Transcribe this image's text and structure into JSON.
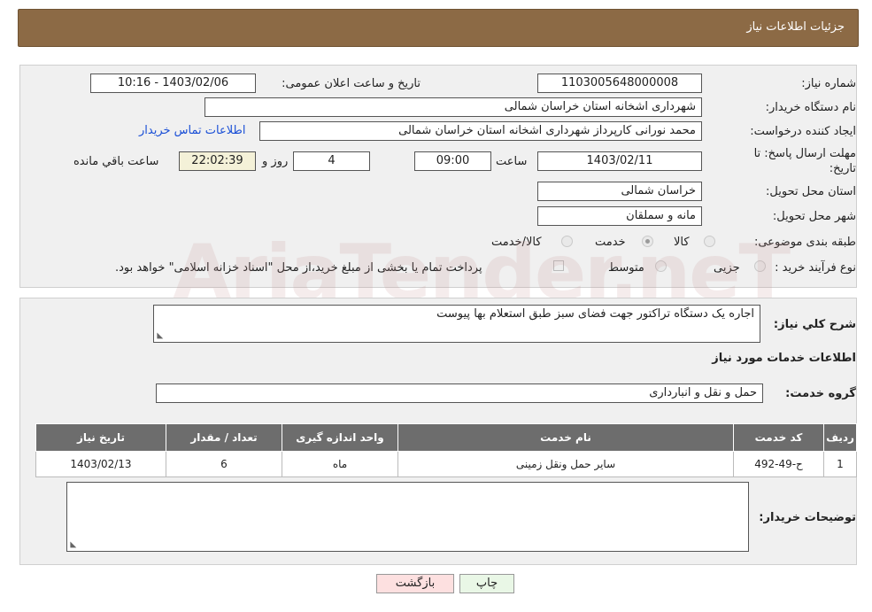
{
  "header": {
    "title": "جزئیات اطلاعات نیاز"
  },
  "form": {
    "need_number_label": "شماره نیاز:",
    "need_number": "1103005648000008",
    "announce_label": "تاریخ و ساعت اعلان عمومی:",
    "announce_value": "1403/02/06 - 10:16",
    "buyer_org_label": "نام دستگاه خریدار:",
    "buyer_org": "شهرداری اشخانه استان خراسان شمالی",
    "creator_label": "ایجاد کننده درخواست:",
    "creator": "محمد نورانی کارپرداز شهرداری اشخانه استان خراسان شمالی",
    "contact_link": "اطلاعات تماس خریدار",
    "deadline_label_1": "مهلت ارسال پاسخ: تا",
    "deadline_label_2": "تاریخ:",
    "deadline_date": "1403/02/11",
    "time_label": "ساعت",
    "deadline_time": "09:00",
    "days_value": "4",
    "days_label": "روز و",
    "remaining_time": "22:02:39",
    "remaining_label": "ساعت باقي مانده",
    "province_label": "استان محل تحویل:",
    "province": "خراسان شمالی",
    "city_label": "شهر محل تحویل:",
    "city": "مانه و سملقان",
    "category_label": "طبقه بندی موضوعی:",
    "category_options": [
      "کالا",
      "خدمت",
      "کالا/خدمت"
    ],
    "category_selected": "خدمت",
    "process_label": "نوع فرآیند خرید :",
    "process_options": [
      "جزیی",
      "متوسط"
    ],
    "payment_note": "پرداخت تمام یا بخشی از مبلغ خرید،از محل \"اسناد خزانه اسلامی\" خواهد بود."
  },
  "details": {
    "summary_label": "شرح کلي نیاز:",
    "summary": "اجاره یک دستگاه تراکتور جهت فضای سبز طبق استعلام بها پیوست",
    "services_heading": "اطلاعات خدمات مورد نیاز",
    "service_group_label": "گروه خدمت:",
    "service_group": "حمل و نقل و انبارداری"
  },
  "table": {
    "headers": [
      "ردیف",
      "کد خدمت",
      "نام خدمت",
      "واحد اندازه گیری",
      "تعداد / مقدار",
      "تاریخ نیاز"
    ],
    "rows": [
      [
        "1",
        "ح-49-492",
        "سایر حمل ونقل زمینی",
        "ماه",
        "6",
        "1403/02/13"
      ]
    ]
  },
  "buyer_notes_label": "توضیحات خریدار:",
  "buttons": {
    "print": "چاپ",
    "back": "بازگشت"
  },
  "watermark": "AriaTender.neT"
}
